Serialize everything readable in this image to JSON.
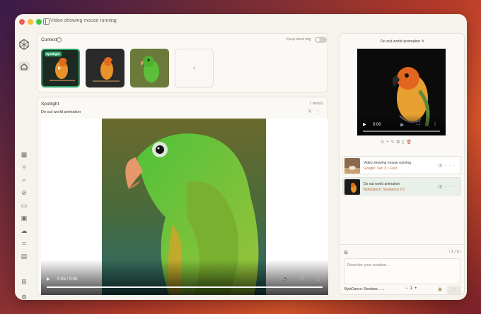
{
  "window": {
    "title": "Video showing mouse running"
  },
  "context": {
    "label": "Context",
    "keep_label": "Keep latest img",
    "spotlight_badge": "Spotlight",
    "add_symbol": "+"
  },
  "spotlight": {
    "label": "Spotlight",
    "count": "1 item(s)",
    "subtitle": "Do out world animation",
    "time": "0:05 / 0:05",
    "progress": 1.0
  },
  "preview": {
    "title": "Do out world animation",
    "time": "0:00",
    "progress": 0.0
  },
  "generations": [
    {
      "title": "Video showing mouse running",
      "model": "Google: Veo 3.1 Fast"
    },
    {
      "title": "Do out world animation",
      "model": "ByteDance: Seedance 2.0"
    }
  ],
  "prompt": {
    "pager": "1 / 3",
    "placeholder": "Describe your creation...",
    "model": "ByteDance: Seedanc...",
    "quantity": "1"
  },
  "colors": {
    "accent_green": "#2fa36b",
    "model_text": "#c3683a",
    "delete_red": "#d0544a"
  }
}
